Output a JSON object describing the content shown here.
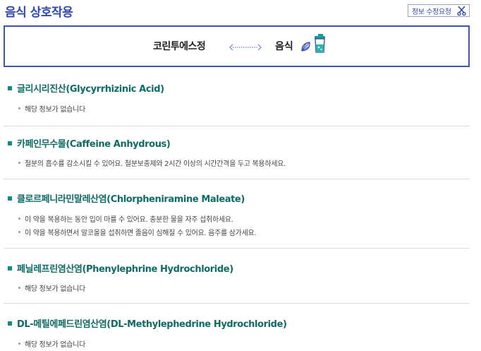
{
  "page": {
    "title": "음식 상호작용"
  },
  "request_button": {
    "label": "정보 수정요청"
  },
  "hero": {
    "drug_name": "코린투에스정",
    "food_label": "음식"
  },
  "sections": [
    {
      "heading": "글리시리진산(Glycyrrhizinic Acid)",
      "lines": [
        "해당 정보가 없습니다"
      ]
    },
    {
      "heading": "카페인무수물(Caffeine Anhydrous)",
      "lines": [
        "철분의 흡수를 감소시킬 수 있어요. 철분보충제와 2시간 이상의 시간간격을 두고 복용하세요."
      ]
    },
    {
      "heading": "클로르페니라민말레산염(Chlorpheniramine Maleate)",
      "lines": [
        "이 약을 복용하는 동안 입이 마를 수 있어요. 충분한 물을 자주 섭취하세요.",
        "이 약을 복용하면서 알코올을 섭취하면 졸음이 심해질 수 있어요. 음주를 삼가세요."
      ]
    },
    {
      "heading": "페닐레프린염산염(Phenylephrine Hydrochloride)",
      "lines": [
        "해당 정보가 없습니다"
      ]
    },
    {
      "heading": "DL-메틸에페드린염산염(DL-Methylephedrine Hydrochloride)",
      "lines": [
        "해당 정보가 없습니다"
      ]
    }
  ],
  "colors": {
    "accent": "#2f49b0",
    "heading": "#0e6b66",
    "bullet": "#0e8c84"
  }
}
